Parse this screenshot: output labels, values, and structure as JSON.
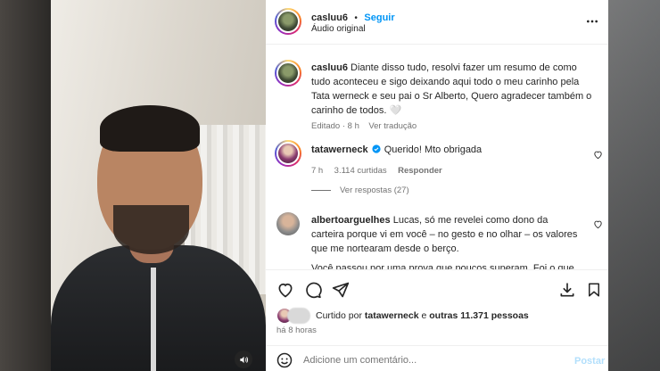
{
  "post": {
    "username": "casluu6",
    "separator": "•",
    "follow_label": "Seguir",
    "audio_label": "Áudio original",
    "more_icon": "more-horizontal-icon"
  },
  "caption": {
    "username": "casluu6",
    "text": "Diante disso tudo, resolvi fazer um resumo de como tudo aconteceu e sigo deixando aqui todo o meu carinho pela Tata werneck e seu pai o Sr Alberto, Quero agradecer também o carinho de todos. 🤍",
    "edited": "Editado · 8 h",
    "translate_label": "Ver tradução"
  },
  "comments": [
    {
      "username": "tatawerneck",
      "verified": true,
      "text": "Querido! Mto obrigada",
      "time": "7 h",
      "likes": "3.114 curtidas",
      "reply_label": "Responder",
      "view_replies": "Ver respostas (27)"
    },
    {
      "username": "albertoarguelhes",
      "text": "Lucas, só me revelei como dono da carteira porque vi em você – no gesto e no olhar – os valores que me nortearam desde o berço.",
      "overflow_text": "Você passou por uma prova que poucos superam. Foi o que"
    }
  ],
  "actions": {
    "liked_by_prefix": "Curtido por",
    "liked_by_user": "tatawerneck",
    "liked_by_mid": "e",
    "liked_by_others": "outras 11.371 pessoas",
    "time_ago": "há 8 horas"
  },
  "composer": {
    "placeholder": "Adicione um comentário...",
    "post_label": "Postar"
  },
  "colors": {
    "accent": "#0095f6",
    "text": "#262626",
    "muted": "#737373"
  }
}
